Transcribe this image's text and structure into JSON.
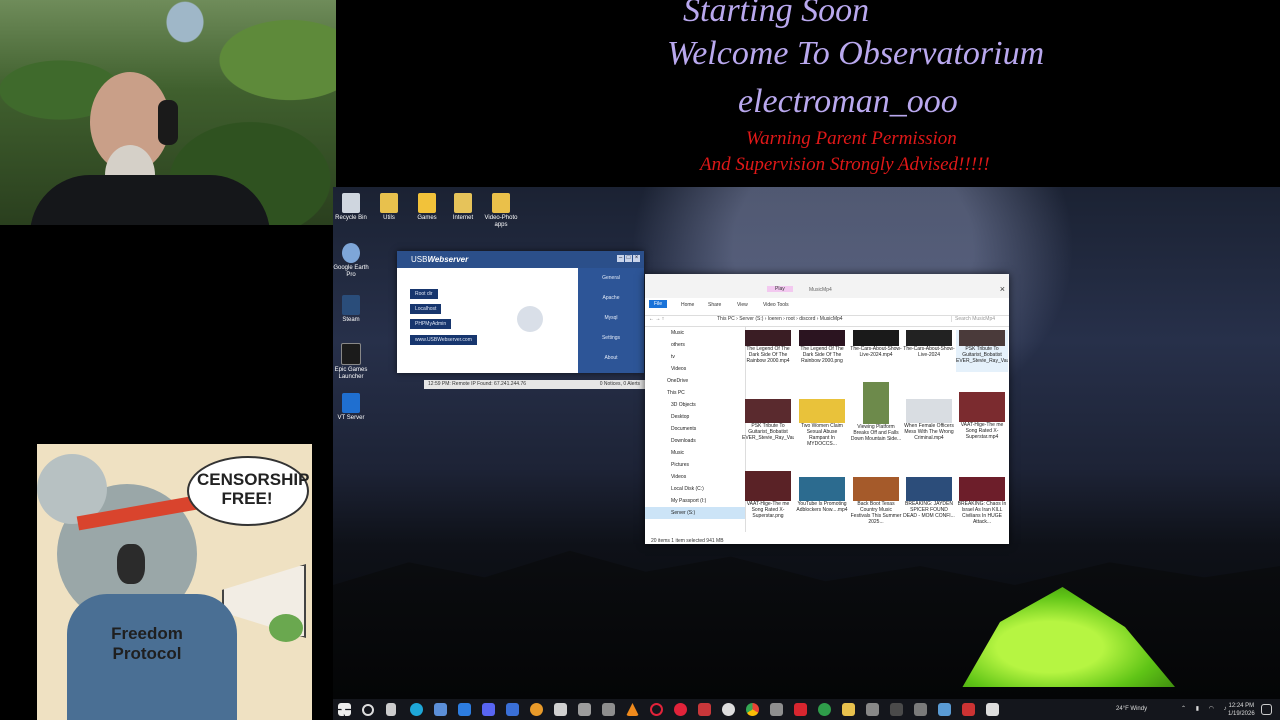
{
  "stream": {
    "line1": "Starting Soon",
    "line2": "Welcome To Observatorium",
    "line3": "electroman_ooo",
    "warning1": "Warning Parent Permission",
    "warning2": "And Supervision Strongly Advised!!!!!"
  },
  "poster": {
    "bubble": "CENSORSHIP FREE!",
    "shirt": "Freedom Protocol"
  },
  "desktop_icons": [
    {
      "label": "Recycle Bin",
      "icon": "recycle-bin-icon"
    },
    {
      "label": "Utils",
      "icon": "folder-icon"
    },
    {
      "label": "Games",
      "icon": "folder-icon"
    },
    {
      "label": "Internet",
      "icon": "folder-icon"
    },
    {
      "label": "Video-Photo apps",
      "icon": "folder-icon"
    },
    {
      "label": "Google Earth Pro",
      "icon": "google-earth-icon"
    },
    {
      "label": "Steam",
      "icon": "steam-icon"
    },
    {
      "label": "Epic Games Launcher",
      "icon": "epic-games-icon"
    },
    {
      "label": "VT Server",
      "icon": "vt-server-icon"
    }
  ],
  "usbwebserver": {
    "title_prefix": "USB",
    "title_suffix": "Webserver",
    "buttons": [
      "Root dir",
      "Localhost",
      "PHPMyAdmin",
      "www.USBWebserver.com"
    ],
    "side_tabs": [
      "General",
      "Apache",
      "Mysql",
      "Settings",
      "About"
    ],
    "status_left": "12:59 PM: Remote IP Found: 67.241.244.76",
    "status_right": "0 Notices, 0 Alerts"
  },
  "explorer": {
    "title": "MusicMp4",
    "ribbon_tabs": [
      "File",
      "Home",
      "Share",
      "View",
      "Video Tools"
    ],
    "play_tab": "Play",
    "address": "This PC  ›  Server (S:)  ›  loeren  ›  root  ›  discord  ›  MusicMp4",
    "search_placeholder": "Search MusicMp4",
    "nav_items": [
      "Music",
      "others",
      "tv",
      "Videos",
      "OneDrive",
      "This PC",
      "3D Objects",
      "Desktop",
      "Documents",
      "Downloads",
      "Music",
      "Pictures",
      "Videos",
      "Local Disk (C:)",
      "My Passport (I:)",
      "Server (S:)"
    ],
    "files": [
      "The Legend Of The Dark Side Of The Rainbow 2000.mp4",
      "The Legend Of The Dark Side Of The Rainbow 2000.png",
      "The-Cars-About-Show-Live-2024.mp4",
      "The-Cars-About-Show-Live-2024",
      "PSK Tribute To Guitarist_Bobatist EVER_Stevie_Ray_Vaughan_Octo...",
      "PSK Tribute To Guitarist_Bobatist EVER_Stevie_Ray_Vaughan_Octo...",
      "Two Women Claim Sexual Abuse Rampant In MYDOCCS...",
      "Viewing Platform Breaks Off and Falls Down Mountain Side...",
      "When Female Officers Mess With The Wrong Criminal.mp4",
      "VAAT-Hige-The me Song Rated X-Superstar.mp4",
      "VAAT-Hige-The me Song Rated X-Superstar.png",
      "YouTube Is Promoting Adblockers Now....mp4",
      "Back Boot Texas Country Music Festivals This Summer 2025...",
      "BREAKING: JAYDEN SPICER FOUND DEAD - MOM CONFI...",
      "BREAKING: Chaos In Israel As Iran KILL Civilians In HUGE Attack..."
    ],
    "status": "20 items    1 item selected  941 MB"
  },
  "tray": {
    "weather": "24°F  Windy",
    "time": "12:24 PM",
    "date": "1/19/2026"
  }
}
